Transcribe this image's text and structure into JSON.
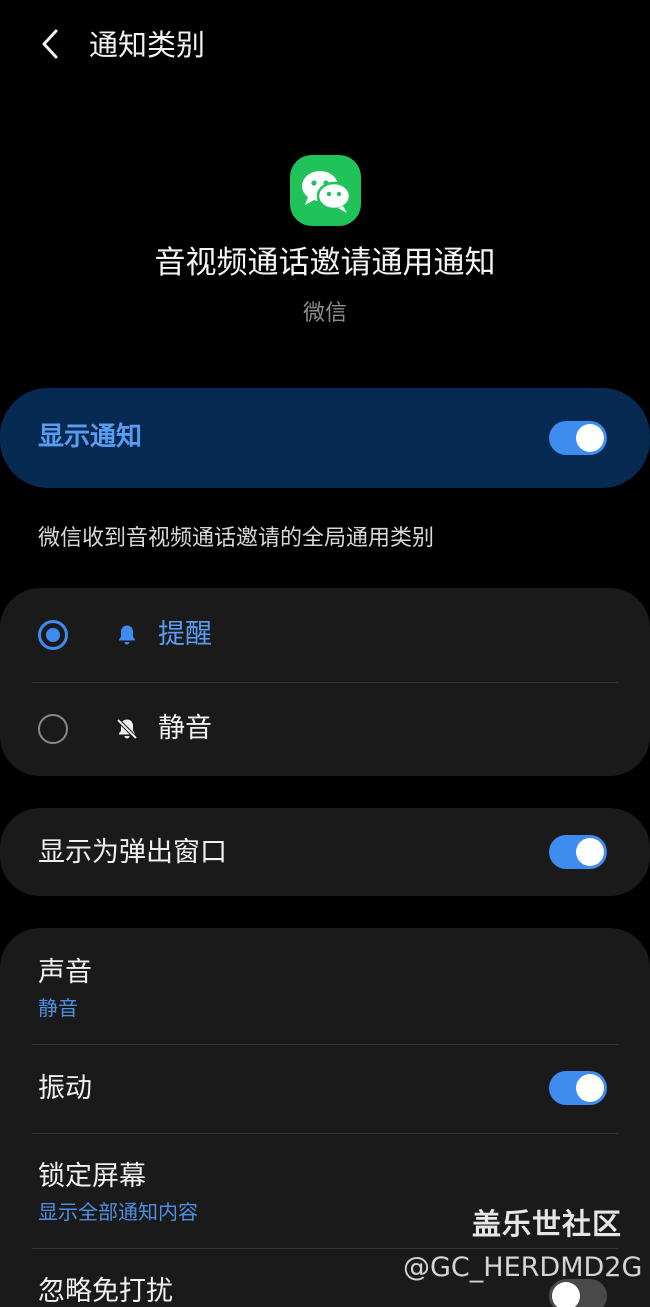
{
  "header": {
    "title": "通知类别",
    "back_icon": "chevron-left-icon"
  },
  "app": {
    "icon": "wechat-logo",
    "icon_color": "#1fc35a",
    "channel_title": "音视频通话邀请通用通知",
    "app_name": "微信"
  },
  "master_switch": {
    "label": "显示通知",
    "on": true
  },
  "description": "微信收到音视频通话邀请的全局通用类别",
  "alert_options": [
    {
      "label": "提醒",
      "icon": "bell-icon",
      "selected": true
    },
    {
      "label": "静音",
      "icon": "bell-off-icon",
      "selected": false
    }
  ],
  "popup": {
    "label": "显示为弹出窗口",
    "on": true
  },
  "settings": {
    "sound": {
      "label": "声音",
      "value": "静音"
    },
    "vibration": {
      "label": "振动",
      "on": true
    },
    "lock_screen": {
      "label": "锁定屏幕",
      "value": "显示全部通知内容"
    },
    "dnd": {
      "label": "忽略免打扰",
      "on": false
    }
  },
  "watermark": {
    "site": "盖乐世社区",
    "user": "@GC_HERDMD2G"
  },
  "colors": {
    "accent": "#3e8cef",
    "accent_text": "#5a9cf0",
    "card_bg": "#1a1a1a",
    "highlight_card_bg": "#062a52"
  }
}
